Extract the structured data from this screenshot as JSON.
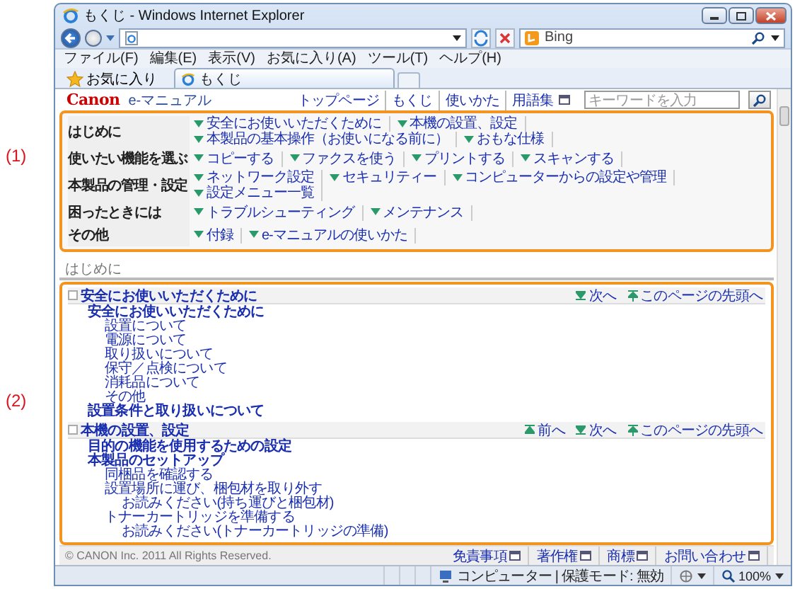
{
  "window": {
    "title": "もくじ - Windows Internet Explorer",
    "search_placeholder": "Bing"
  },
  "menu": [
    "ファイル(F)",
    "編集(E)",
    "表示(V)",
    "お気に入り(A)",
    "ツール(T)",
    "ヘルプ(H)"
  ],
  "favorites": {
    "label": "お気に入り",
    "tab": "もくじ"
  },
  "header": {
    "logo": "Canon",
    "subtitle": "e-マニュアル",
    "links": [
      {
        "label": "トップページ",
        "popup": false
      },
      {
        "label": "もくじ",
        "popup": false
      },
      {
        "label": "使いかた",
        "popup": false
      },
      {
        "label": "用語集",
        "popup": true
      }
    ],
    "search_placeholder": "キーワードを入力"
  },
  "callouts": [
    "(1)",
    "(2)"
  ],
  "nav": [
    {
      "label": "はじめに",
      "links": [
        "安全にお使いいただくために",
        "本機の設置、設定",
        "本製品の基本操作（お使いになる前に）",
        "おもな仕様"
      ]
    },
    {
      "label": "使いたい機能を選ぶ",
      "links": [
        "コピーする",
        "ファクスを使う",
        "プリントする",
        "スキャンする"
      ]
    },
    {
      "label": "本製品の管理・設定",
      "links": [
        "ネットワーク設定",
        "セキュリティー",
        "コンピューターからの設定や管理",
        "設定メニュー一覧"
      ]
    },
    {
      "label": "困ったときには",
      "links": [
        "トラブルシューティング",
        "メンテナンス"
      ]
    },
    {
      "label": "その他",
      "links": [
        "付録",
        "e-マニュアルの使いかた"
      ]
    }
  ],
  "breadcrumb": "はじめに",
  "sections": [
    {
      "title": "安全にお使いいただくために",
      "nav": [
        {
          "kind": "next",
          "label": "次へ"
        },
        {
          "kind": "top",
          "label": "このページの先頭へ"
        }
      ],
      "items": [
        {
          "text": "安全にお使いいただくために",
          "children": [
            {
              "text": "設置について"
            },
            {
              "text": "電源について"
            },
            {
              "text": "取り扱いについて"
            },
            {
              "text": "保守／点検について"
            },
            {
              "text": "消耗品について"
            },
            {
              "text": "その他"
            }
          ]
        },
        {
          "text": "設置条件と取り扱いについて"
        }
      ]
    },
    {
      "title": "本機の設置、設定",
      "nav": [
        {
          "kind": "prev",
          "label": "前へ"
        },
        {
          "kind": "next",
          "label": "次へ"
        },
        {
          "kind": "top",
          "label": "このページの先頭へ"
        }
      ],
      "items": [
        {
          "text": "目的の機能を使用するための設定"
        },
        {
          "text": "本製品のセットアップ",
          "children": [
            {
              "text": "同梱品を確認する"
            },
            {
              "text": "設置場所に運び、梱包材を取り外す",
              "children": [
                {
                  "text": "お読みください(持ち運びと梱包材)"
                }
              ]
            },
            {
              "text": "トナーカートリッジを準備する",
              "children": [
                {
                  "text": "お読みください(トナーカートリッジの準備)"
                }
              ]
            }
          ]
        }
      ]
    }
  ],
  "footer": {
    "copyright": "© CANON Inc. 2011 All Rights Reserved.",
    "links": [
      "免責事項",
      "著作権",
      "商標",
      "お問い合わせ"
    ]
  },
  "status": {
    "zone": "コンピューター | 保護モード: 無効",
    "zoom": "100%"
  }
}
